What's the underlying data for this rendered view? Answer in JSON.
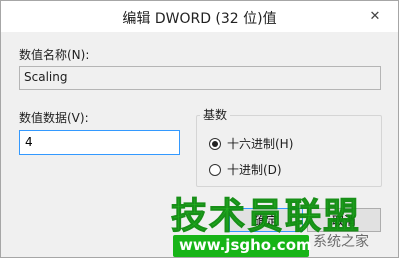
{
  "window": {
    "title": "编辑 DWORD (32 位)值",
    "close_glyph": "✕"
  },
  "value_name": {
    "label": "数值名称(N):",
    "value": "Scaling"
  },
  "value_data": {
    "label": "数值数据(V):",
    "value": "4"
  },
  "base": {
    "label": "基数",
    "options": [
      {
        "label": "十六进制(H)",
        "selected": true
      },
      {
        "label": "十进制(D)",
        "selected": false
      }
    ]
  },
  "buttons": {
    "ok_label": "确定",
    "cancel_label": "取消"
  },
  "watermark": {
    "main_text": "技术员联盟",
    "url": "www.jsgho.com",
    "tag": "系统之家"
  },
  "colors": {
    "focus_border": "#3399ff",
    "watermark_green": "#17b417"
  }
}
